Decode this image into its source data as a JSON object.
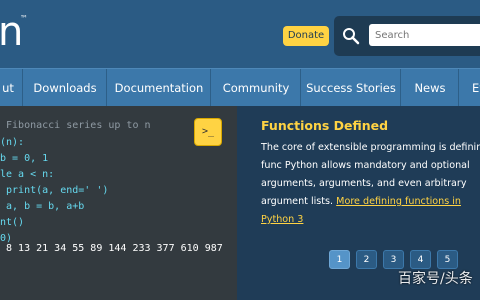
{
  "header": {
    "logo_text": "n",
    "trademark": "™",
    "donate_label": "Donate",
    "search_placeholder": "Search"
  },
  "nav": {
    "items": [
      {
        "label": "ut"
      },
      {
        "label": "Downloads"
      },
      {
        "label": "Documentation"
      },
      {
        "label": "Community"
      },
      {
        "label": "Success Stories"
      },
      {
        "label": "News"
      },
      {
        "label": "Ev"
      }
    ]
  },
  "code": {
    "lines": [
      " Fibonacci series up to n",
      "(n):",
      "b = 0, 1",
      "le a < n:",
      " print(a, end=' ')",
      " a, b = b, a+b",
      "nt()",
      "0)",
      " 8 13 21 34 55 89 144 233 377 610 987"
    ],
    "launch_label": ">_"
  },
  "feature": {
    "title": "Functions Defined",
    "text": "The core of extensible programming is defining func Python allows mandatory and optional arguments, arguments, and even arbitrary argument lists.",
    "link": "More defining functions in Python 3"
  },
  "pager": {
    "pages": [
      "1",
      "2",
      "3",
      "4",
      "5"
    ],
    "active": "1"
  },
  "watermark": "百家号/头条",
  "colors": {
    "header_bg": "#2b5b84",
    "nav_bg": "#3c78aa",
    "accent_yellow": "#ffd343",
    "code_bg": "#333a3f",
    "info_bg": "#1f3c57"
  }
}
